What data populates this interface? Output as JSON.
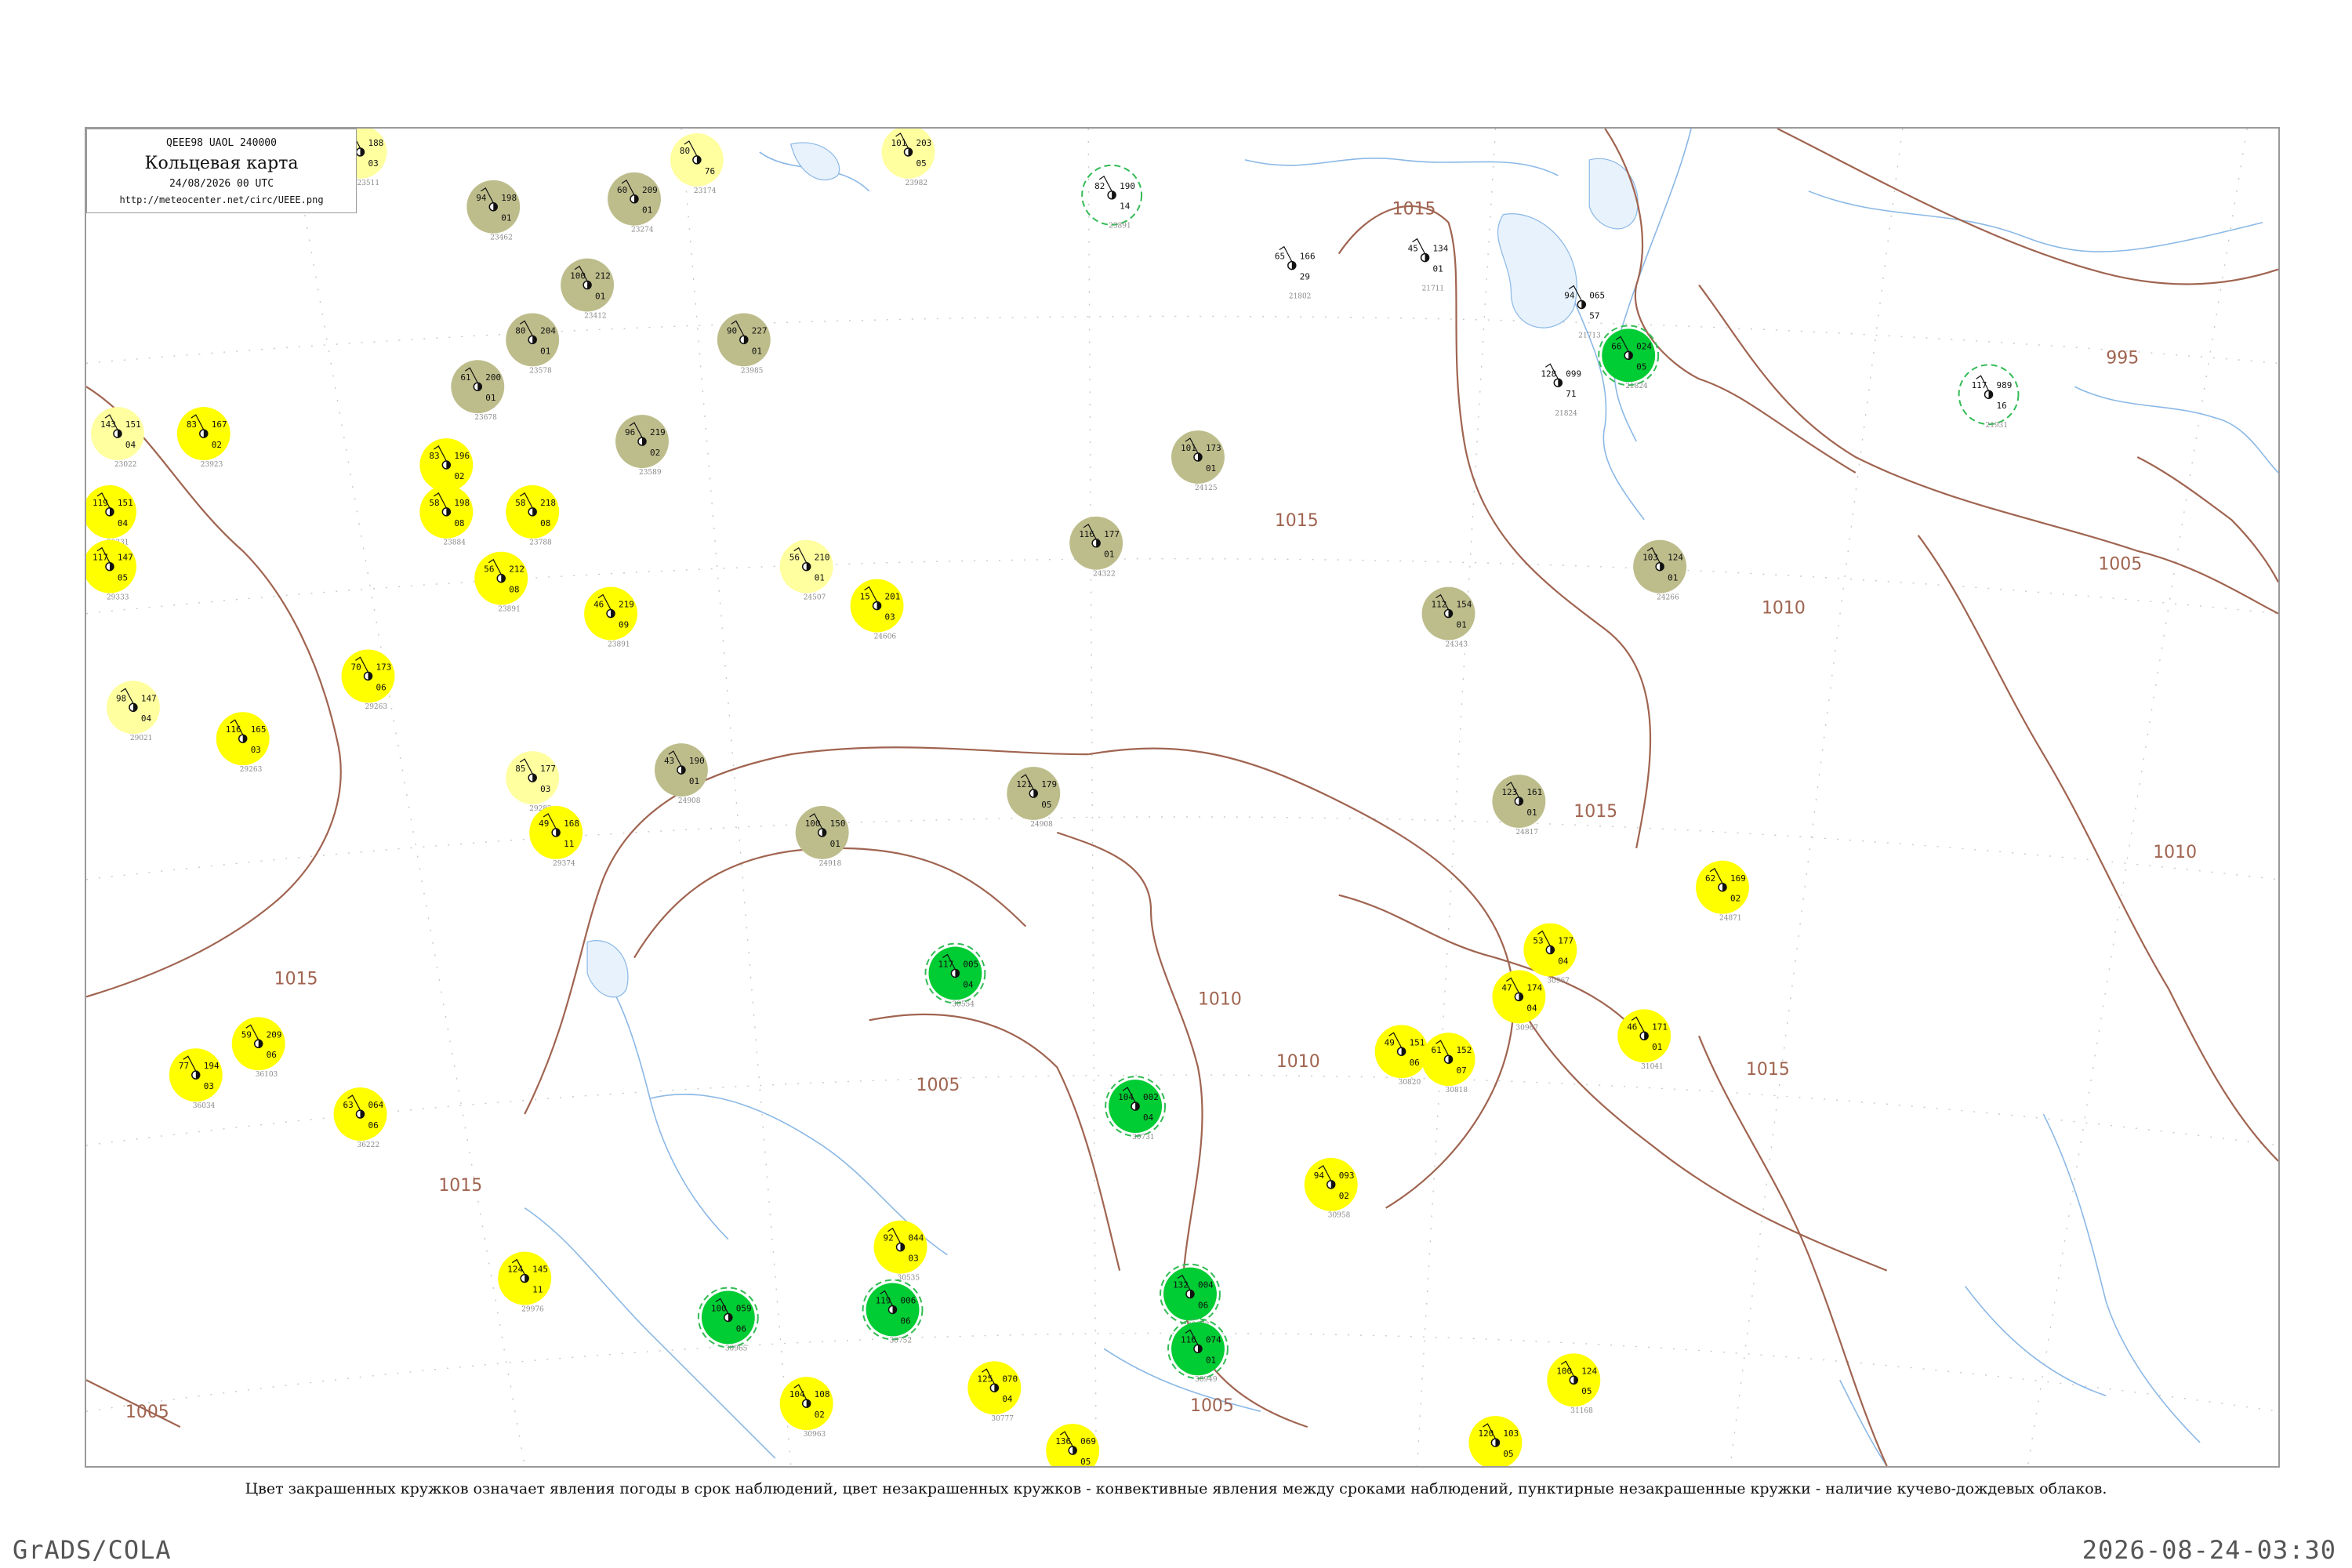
{
  "map": {
    "code": "QEEE98  UAOL  240000",
    "title": "Кольцевая карта",
    "datetime": "24/08/2026 00 UTC",
    "url": "http://meteocenter.net/circ/UEEE.png"
  },
  "caption": "Цвет закрашенных кружков означает явления погоды в срок наблюдений, цвет незакрашенных кружков - конвективные явления между сроками наблюдений, пунктирные незакрашенные кружки - наличие кучево-дождевых облаков.",
  "footer": {
    "left": "GrADS/COLA",
    "right": "2026-08-24-03:30"
  },
  "colors": {
    "isobar": "#a06450",
    "river": "#8ab8e6",
    "yellow": "#ffff00",
    "light_yellow": "#ffffa0",
    "khaki": "#bdbd8c",
    "green": "#00cc33",
    "dashed_green": "#33bb55"
  },
  "isobar_labels": [
    "1015",
    "1015",
    "1015",
    "1015",
    "1015",
    "1015",
    "1015",
    "1010",
    "1010",
    "1010",
    "1005",
    "1005",
    "1005",
    "1005",
    "995",
    "1010"
  ],
  "stations": [
    {
      "name": "Тагна-Саян",
      "p": "188",
      "t": "97",
      "dt": "03",
      "id": "23511",
      "c": "yellow-light"
    },
    {
      "name": "",
      "p": "198",
      "t": "94",
      "dt": "01",
      "id": "23462",
      "c": "khaki"
    },
    {
      "name": "",
      "p": "209",
      "t": "60",
      "dt": "01",
      "id": "23274",
      "c": "khaki"
    },
    {
      "name": "",
      "p": "",
      "t": "80",
      "dt": "76",
      "id": "23174",
      "c": "light-yellow"
    },
    {
      "name": "",
      "p": "203",
      "t": "101",
      "dt": "05",
      "id": "23982",
      "c": "light-yellow"
    },
    {
      "name": "",
      "p": "190",
      "t": "82",
      "dt": "14",
      "id": "23891",
      "c": "green-ring"
    },
    {
      "name": "",
      "p": "134",
      "t": "45",
      "dt": "01",
      "id": "21711",
      "c": "none"
    },
    {
      "name": "",
      "p": "166",
      "t": "65",
      "dt": "29",
      "id": "21802",
      "c": "none"
    },
    {
      "name": "",
      "p": "065",
      "t": "94",
      "dt": "57",
      "id": "21713",
      "c": "none"
    },
    {
      "name": "",
      "p": "024",
      "t": "66",
      "dt": "05",
      "id": "21824",
      "c": "green"
    },
    {
      "name": "",
      "p": "099",
      "t": "128",
      "dt": "71",
      "id": "21824",
      "c": "none"
    },
    {
      "name": "",
      "p": "989",
      "t": "117",
      "dt": "16",
      "id": "21931",
      "c": "green-ring"
    },
    {
      "name": "",
      "p": "212",
      "t": "100",
      "dt": "01",
      "id": "23412",
      "c": "khaki"
    },
    {
      "name": "",
      "p": "227",
      "t": "90",
      "dt": "01",
      "id": "23985",
      "c": "khaki"
    },
    {
      "name": "",
      "p": "204",
      "t": "80",
      "dt": "01",
      "id": "23578",
      "c": "khaki"
    },
    {
      "name": "",
      "p": "200",
      "t": "61",
      "dt": "01",
      "id": "23678",
      "c": "khaki"
    },
    {
      "name": "",
      "p": "219",
      "t": "96",
      "dt": "02",
      "id": "23589",
      "c": "khaki"
    },
    {
      "name": "",
      "p": "173",
      "t": "101",
      "dt": "01",
      "id": "24125",
      "c": "khaki"
    },
    {
      "name": "",
      "p": "177",
      "t": "116",
      "dt": "01",
      "id": "24322",
      "c": "khaki"
    },
    {
      "name": "",
      "p": "154",
      "t": "112",
      "dt": "01",
      "id": "24343",
      "c": "khaki"
    },
    {
      "name": "",
      "p": "124",
      "t": "103",
      "dt": "01",
      "id": "24266",
      "c": "khaki"
    },
    {
      "name": "",
      "p": "151",
      "t": "143",
      "dt": "04",
      "id": "23022",
      "c": "light-yellow"
    },
    {
      "name": "",
      "p": "167",
      "t": "83",
      "dt": "02",
      "id": "23923",
      "c": "yellow"
    },
    {
      "name": "",
      "p": "151",
      "t": "119",
      "dt": "04",
      "id": "29331",
      "c": "yellow"
    },
    {
      "name": "",
      "p": "147",
      "t": "117",
      "dt": "05",
      "id": "29333",
      "c": "yellow"
    },
    {
      "name": "",
      "p": "196",
      "t": "83",
      "dt": "02",
      "id": "23774",
      "c": "yellow"
    },
    {
      "name": "",
      "p": "198",
      "t": "58",
      "dt": "08",
      "id": "23884",
      "c": "yellow"
    },
    {
      "name": "",
      "p": "218",
      "t": "58",
      "dt": "08",
      "id": "23788",
      "c": "yellow"
    },
    {
      "name": "",
      "p": "212",
      "t": "56",
      "dt": "08",
      "id": "23891",
      "c": "yellow"
    },
    {
      "name": "",
      "p": "219",
      "t": "46",
      "dt": "09",
      "id": "23891",
      "c": "yellow"
    },
    {
      "name": "",
      "p": "201",
      "t": "15",
      "dt": "03",
      "id": "24606",
      "c": "yellow"
    },
    {
      "name": "",
      "p": "210",
      "t": "56",
      "dt": "01",
      "id": "24507",
      "c": "light-yellow"
    },
    {
      "name": "",
      "p": "173",
      "t": "70",
      "dt": "06",
      "id": "29263",
      "c": "yellow"
    },
    {
      "name": "",
      "p": "147",
      "t": "98",
      "dt": "04",
      "id": "29021",
      "c": "light-yellow"
    },
    {
      "name": "",
      "p": "165",
      "t": "116",
      "dt": "03",
      "id": "29263",
      "c": "yellow"
    },
    {
      "name": "",
      "p": "190",
      "t": "43",
      "dt": "01",
      "id": "24908",
      "c": "khaki"
    },
    {
      "name": "",
      "p": "177",
      "t": "85",
      "dt": "03",
      "id": "29282",
      "c": "light-yellow"
    },
    {
      "name": "",
      "p": "179",
      "t": "121",
      "dt": "05",
      "id": "24908",
      "c": "khaki"
    },
    {
      "name": "",
      "p": "150",
      "t": "100",
      "dt": "01",
      "id": "24918",
      "c": "khaki"
    },
    {
      "name": "",
      "p": "161",
      "t": "123",
      "dt": "01",
      "id": "24817",
      "c": "khaki"
    },
    {
      "name": "",
      "p": "168",
      "t": "49",
      "dt": "11",
      "id": "29374",
      "c": "yellow"
    },
    {
      "name": "",
      "p": "169",
      "t": "62",
      "dt": "02",
      "id": "24871",
      "c": "yellow"
    },
    {
      "name": "",
      "p": "177",
      "t": "53",
      "dt": "04",
      "id": "30967",
      "c": "yellow"
    },
    {
      "name": "",
      "p": "174",
      "t": "47",
      "dt": "04",
      "id": "30967",
      "c": "yellow"
    },
    {
      "name": "",
      "p": "171",
      "t": "46",
      "dt": "01",
      "id": "31041",
      "c": "yellow"
    },
    {
      "name": "",
      "p": "151",
      "t": "49",
      "dt": "06",
      "id": "30820",
      "c": "yellow"
    },
    {
      "name": "",
      "p": "152",
      "t": "61",
      "dt": "07",
      "id": "30818",
      "c": "yellow"
    },
    {
      "name": "",
      "p": "093",
      "t": "94",
      "dt": "02",
      "id": "30958",
      "c": "yellow"
    },
    {
      "name": "",
      "p": "044",
      "t": "92",
      "dt": "03",
      "id": "30535",
      "c": "yellow"
    },
    {
      "name": "",
      "p": "070",
      "t": "125",
      "dt": "04",
      "id": "30777",
      "c": "yellow"
    },
    {
      "name": "",
      "p": "069",
      "t": "136",
      "dt": "05",
      "id": "30879",
      "c": "yellow"
    },
    {
      "name": "",
      "p": "108",
      "t": "104",
      "dt": "02",
      "id": "30963",
      "c": "yellow"
    },
    {
      "name": "",
      "p": "103",
      "t": "120",
      "dt": "05",
      "id": "31052",
      "c": "yellow"
    },
    {
      "name": "",
      "p": "124",
      "t": "100",
      "dt": "05",
      "id": "31168",
      "c": "yellow"
    },
    {
      "name": "",
      "p": "145",
      "t": "124",
      "dt": "11",
      "id": "29976",
      "c": "yellow"
    },
    {
      "name": "",
      "p": "209",
      "t": "59",
      "dt": "06",
      "id": "36103",
      "c": "yellow"
    },
    {
      "name": "",
      "p": "194",
      "t": "77",
      "dt": "03",
      "id": "36034",
      "c": "yellow"
    },
    {
      "name": "",
      "p": "064",
      "t": "63",
      "dt": "06",
      "id": "36222",
      "c": "yellow"
    },
    {
      "name": "",
      "p": "005",
      "t": "117",
      "dt": "04",
      "id": "30554",
      "c": "green"
    },
    {
      "name": "",
      "p": "002",
      "t": "104",
      "dt": "04",
      "id": "30731",
      "c": "green"
    },
    {
      "name": "",
      "p": "006",
      "t": "119",
      "dt": "06",
      "id": "30752",
      "c": "green"
    },
    {
      "name": "",
      "p": "004",
      "t": "132",
      "dt": "06",
      "id": "30673",
      "c": "green"
    },
    {
      "name": "",
      "p": "059",
      "t": "100",
      "dt": "06",
      "id": "30965",
      "c": "green"
    },
    {
      "name": "",
      "p": "074",
      "t": "116",
      "dt": "01",
      "id": "30949",
      "c": "green"
    }
  ],
  "station_ids": [
    "23412",
    "23589",
    "23678",
    "24125",
    "24266",
    "24343",
    "24507",
    "24606",
    "24817",
    "24908",
    "24918",
    "29021",
    "29263",
    "29282",
    "29374",
    "30535",
    "30554",
    "30673",
    "30731",
    "30752",
    "30777",
    "30818",
    "30820",
    "30879",
    "30949",
    "30958",
    "30963",
    "30965",
    "30967",
    "31041",
    "31052",
    "31168",
    "36034",
    "36103",
    "36222"
  ]
}
